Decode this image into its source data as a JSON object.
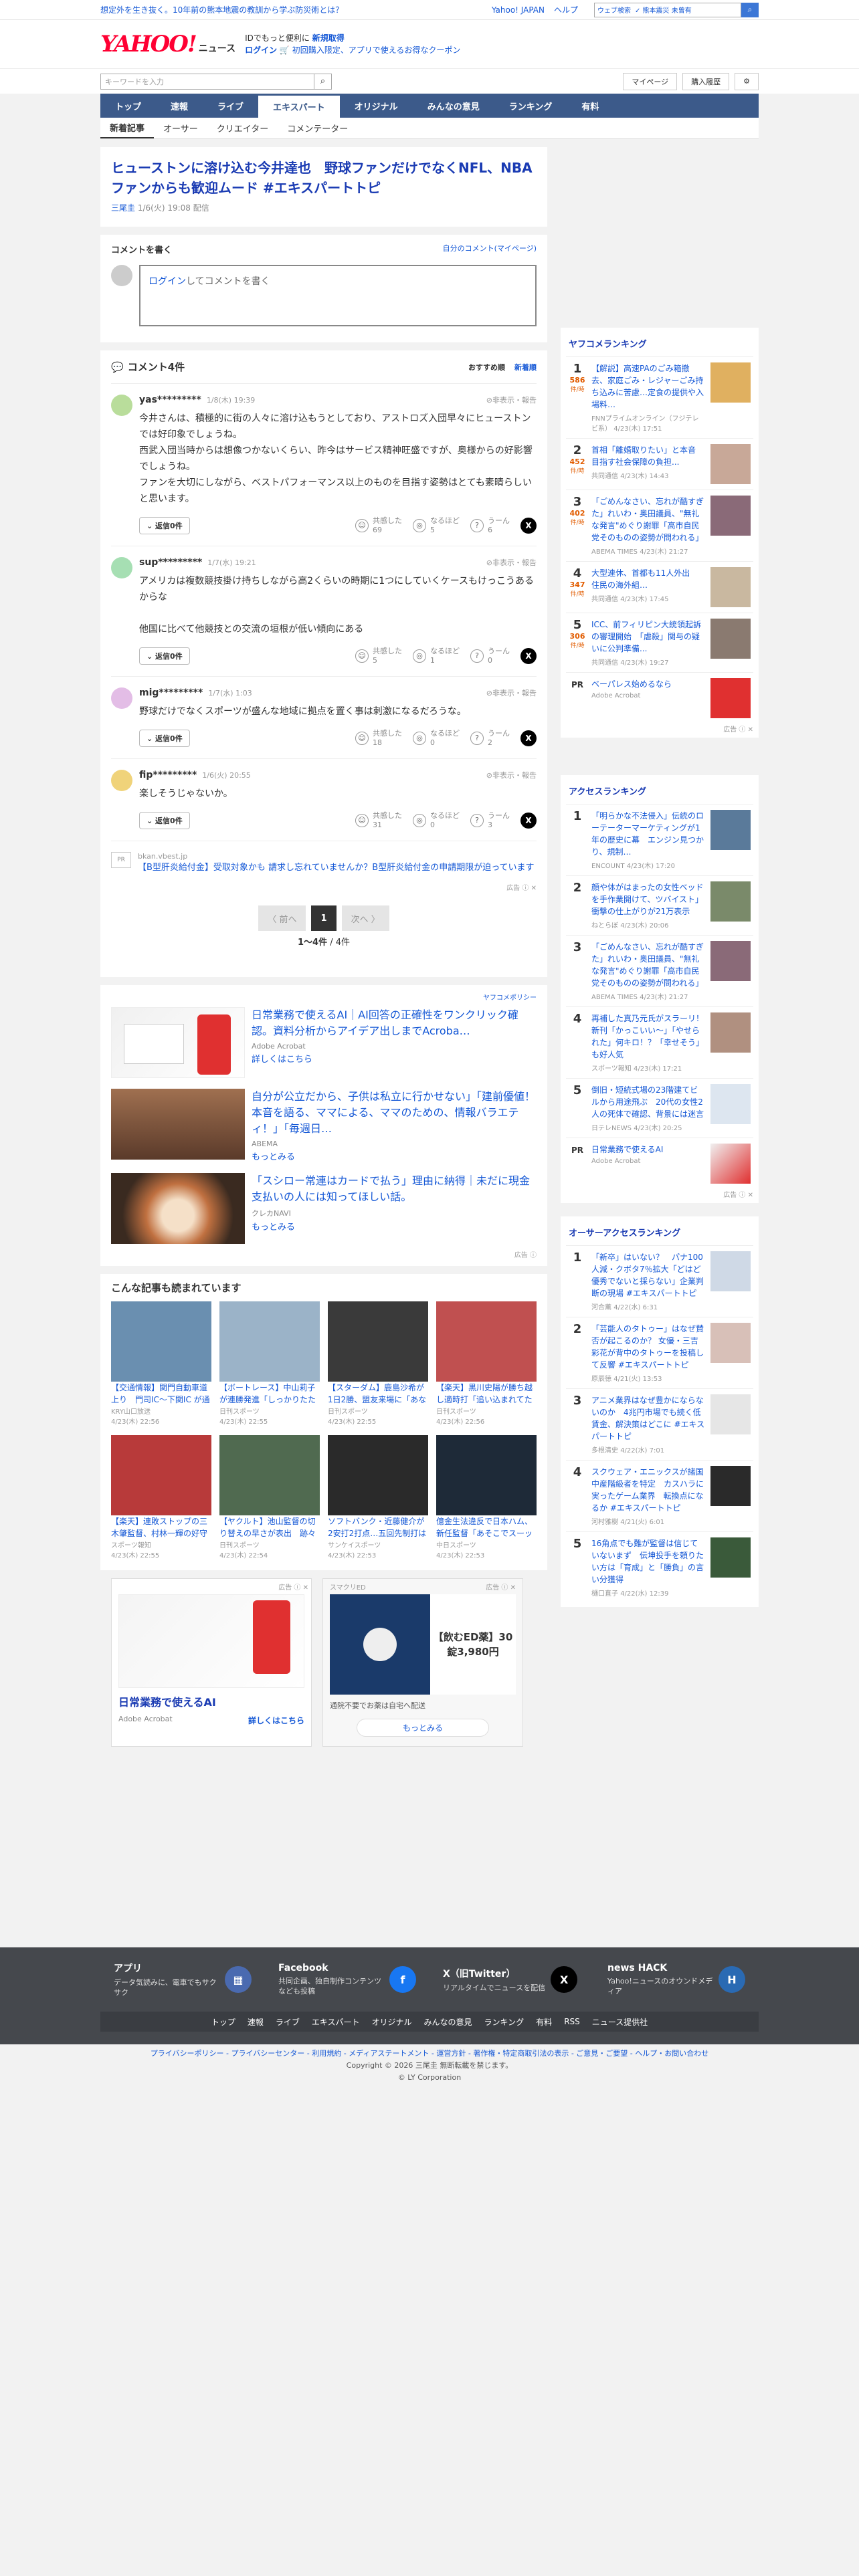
{
  "topbar": {
    "promo": "想定外を生き抜く。10年前の熊本地震の教訓から学ぶ防災術とは？",
    "links": [
      "Yahoo! JAPAN",
      "ヘルプ"
    ],
    "search_placeholder": "ウェブ検索",
    "search_tag": "✓ 熊本震災 未曾有"
  },
  "header": {
    "logo": "YAHOO!",
    "logo_sub": "JAPAN",
    "logo_news": "ニュース",
    "promo1": "IDでもっと便利に",
    "promo1b": "新規取得",
    "promo2a": "ログイン",
    "promo2b": "初回購入限定、アプリで使えるお得なクーポン"
  },
  "search": {
    "placeholder": "キーワードを入力",
    "mypage": "マイページ",
    "history": "購入履歴"
  },
  "nav": {
    "items": [
      "トップ",
      "速報",
      "ライブ",
      "エキスパート",
      "オリジナル",
      "みんなの意見",
      "ランキング",
      "有料"
    ],
    "active": 3
  },
  "subnav": {
    "items": [
      "新着記事",
      "オーサー",
      "クリエイター",
      "コメンテーター"
    ]
  },
  "article": {
    "title": "ヒューストンに溶け込む今井達也　野球ファンだけでなくNFL、NBAファンからも歓迎ムード #エキスパートトピ",
    "author": "三尾圭",
    "date": "1/6(火) 19:08 配信"
  },
  "comment_write": {
    "heading": "コメントを書く",
    "my_comments": "自分のコメント(マイページ)",
    "login": "ログイン",
    "placeholder": "してコメントを書く"
  },
  "comments": {
    "heading": "コメント4件",
    "sort_recommended": "おすすめ順",
    "sort_new": "新着順",
    "report": "非表示・報告",
    "reply_label": "返信0件",
    "items": [
      {
        "name": "yas*********",
        "time": "1/8(木) 19:39",
        "text": "今井さんは、積極的に街の人々に溶け込もうとしており、アストロズ入団早々にヒューストンでは好印象でしょうね。\n西武入団当時からは想像つかないくらい、昨今はサービス精神旺盛ですが、奥様からの好影響でしょうね。\nファンを大切にしながら、ベストパフォーマンス以上のものを目指す姿勢はとても素晴らしいと思います。",
        "agree": "69",
        "think": "5",
        "hmm": "6",
        "avatar": "#b9dd9b"
      },
      {
        "name": "sup*********",
        "time": "1/7(水) 19:21",
        "text": "アメリカは複数競技掛け持ちしながら高2くらいの時期に1つにしていくケースもけっこうあるからな\n\n他国に比べて他競技との交流の垣根が低い傾向にある",
        "agree": "5",
        "think": "1",
        "hmm": "0",
        "avatar": "#a6dfb3"
      },
      {
        "name": "mig*********",
        "time": "1/7(水) 1:03",
        "text": "野球だけでなくスポーツが盛んな地域に拠点を置く事は刺激になるだろうな。",
        "agree": "18",
        "think": "0",
        "hmm": "2",
        "avatar": "#e3bde6"
      },
      {
        "name": "fip*********",
        "time": "1/6(火) 20:55",
        "text": "楽しそうじゃないか。",
        "agree": "31",
        "think": "0",
        "hmm": "3",
        "avatar": "#f0d37a"
      }
    ],
    "react_agree": "共感した",
    "react_think": "なるほど",
    "react_hmm": "うーん"
  },
  "pr_ad": {
    "badge": "PR",
    "source": "bkan.vbest.jp",
    "text": "【B型肝炎給付金】受取対象かも 請求し忘れていませんか？B型肝炎給付金の申請期限が迫っています",
    "admark": "広告 ⓘ ✕"
  },
  "pager": {
    "prev": "〈 前へ",
    "cur": "1",
    "next": "次へ 〉",
    "count_a": "1〜4件",
    "count_b": " / 4件"
  },
  "adlist": {
    "policy": "ヤフコメポリシー",
    "items": [
      {
        "title": "日常業務で使えるAI｜AI回答の正確性をワンクリック確認。資料分析からアイデア出しまでAcroba…",
        "src": "Adobe Acrobat",
        "more": "詳しくはこちら"
      },
      {
        "title": "自分が公立だから、子供は私立に行かせない」「建前優値！本音を語る、ママによる、ママのための、情報バラエティ！」「毎週日…",
        "src": "ABEMA",
        "more": "もっとみる"
      },
      {
        "title": "「スシロー常連はカードで払う」理由に納得｜未だに現金支払いの人には知ってほしい話。",
        "src": "クレカNAVI",
        "more": "もっとみる"
      }
    ],
    "admark": "広告 ⓘ"
  },
  "recs": {
    "heading": "こんな記事も読まれています",
    "items": [
      {
        "t": "【交通情報】関門自動車道上り　門司IC〜下関IC が通行止め　雪・凍結…",
        "s": "KRY山口放送",
        "d": "4/23(木) 22:56",
        "c": "#6a8fb0"
      },
      {
        "t": "【ボートレース】中山莉子が連勝発進「しっかりたたいたら、もう…",
        "s": "日刊スポーツ",
        "d": "4/23(木) 22:55",
        "c": "#9bb3c8"
      },
      {
        "t": "【スターダム】鹿島沙希が1日2勝、盟友来場に「あなたは本当…",
        "s": "日刊スポーツ",
        "d": "4/23(木) 22:55",
        "c": "#3a3a3a"
      },
      {
        "t": "【楽天】黒川史陽が勝ち越し適時打「追い込まれてたんで、なん…",
        "s": "日刊スポーツ",
        "d": "4/23(木) 22:56",
        "c": "#c05050"
      },
      {
        "t": "【楽天】連敗ストップの三木肇監督、村林一輝の好守備を称賛「…",
        "s": "スポーツ報知",
        "d": "4/23(木) 22:55",
        "c": "#b83a3a"
      },
      {
        "t": "【ヤクルト】池山監督の切り替えの早さが表出　跡々と受け継が…",
        "s": "日刊スポーツ",
        "d": "4/23(木) 22:54",
        "c": "#506a50"
      },
      {
        "t": "ソフトバンク・近藤健介が2安打2打点…五回先制打は「反応で打…",
        "s": "サンケイスポーツ",
        "d": "4/23(木) 22:53",
        "c": "#2a2a2a"
      },
      {
        "t": "億金生法違反で日本ハム、新任監督「あそこでスーッとストライ…",
        "s": "中日スポーツ",
        "d": "4/23(木) 22:53",
        "c": "#1e2a38"
      }
    ]
  },
  "bottom_ads": [
    {
      "title": "日常業務で使えるAI",
      "src": "Adobe Acrobat",
      "more": "詳しくはこちら"
    },
    {
      "title": "【飲むED薬】30錠3,980円",
      "brand": "スマクリED",
      "src": "スマクリED",
      "note": "通院不要でお薬は自宅へ配送",
      "more": "もっとみる"
    }
  ],
  "side_yahocome": {
    "heading": "ヤフコメランキング",
    "items": [
      {
        "n": "1",
        "c": "586",
        "u": "件/時",
        "t": "【解説】高速PAのごみ箱撤去、家庭ごみ・レジャーごみ持ち込みに苦慮…定食の提供や入場料…",
        "s": "FNNプライムオンライン（フジテレビ系）",
        "d": "4/23(木) 17:51",
        "img": "#e0b060"
      },
      {
        "n": "2",
        "c": "452",
        "u": "件/時",
        "t": "首相「離婚取りたい」と本音　目指す社会保障の負担...",
        "s": "共同通信",
        "d": "4/23(木) 14:43",
        "img": "#c8a898"
      },
      {
        "n": "3",
        "c": "402",
        "u": "件/時",
        "t": "「ごめんなさい、忘れが酷すぎた」れいわ・奥田議員、\"無礼な発言\"めぐり謝罪「高市自民党そのものの姿勢が問われる」",
        "s": "ABEMA TIMES",
        "d": "4/23(木) 21:27",
        "img": "#8a6a78"
      },
      {
        "n": "4",
        "c": "347",
        "u": "件/時",
        "t": "大型連休、首都も11人外出　住民の海外組…",
        "s": "共同通信",
        "d": "4/23(木) 17:45",
        "img": "#c9b8a0"
      },
      {
        "n": "5",
        "c": "306",
        "u": "件/時",
        "t": "ICC、前フィリピン大統領起訴の審理開始　「虐殺」関与の疑いに公判準備...",
        "s": "共同通信",
        "d": "4/23(木) 19:27",
        "img": "#8a7a70"
      }
    ],
    "pr": {
      "t": "ベーパレス始めるなら",
      "s": "Adobe Acrobat"
    },
    "admark": "広告 ⓘ ✕"
  },
  "side_access": {
    "heading": "アクセスランキング",
    "items": [
      {
        "n": "1",
        "t": "「明らかな不法侵入」伝統のローテーターマーケティングが1年の歴史に幕　エンジン見つかり、規制…",
        "s": "ENCOUNT",
        "d": "4/23(木) 17:20",
        "img": "#5a7a9a"
      },
      {
        "n": "2",
        "t": "顔や体がはまったの女性ベッドを手作業開けて、ツバイスト」衝撃の仕上がりが21万表示",
        "s": "ねとらぼ",
        "d": "4/23(木) 20:06",
        "img": "#7a8a6a"
      },
      {
        "n": "3",
        "t": "「ごめんなさい、忘れが酷すぎた」れいわ・奥田議員、\"無礼な発言\"めぐり謝罪「高市自民党そのものの姿勢が問われる」",
        "s": "ABEMA TIMES",
        "d": "4/23(木) 21:27",
        "img": "#8a6a78"
      },
      {
        "n": "4",
        "t": "再補した真乃元氏がスラーリ！新刊「かっこいい〜」「やせられた」何キロ！？「幸せそう」も好人気",
        "s": "スポーツ報知",
        "d": "4/23(木) 17:21",
        "img": "#b09080"
      },
      {
        "n": "5",
        "t": "倒旧・短統式場の23階建てビルから用途飛ぶ　20代の女性2人の死体で確認、背景には迷言",
        "s": "日テレNEWS",
        "d": "4/23(木) 20:25",
        "img": "#dde6f0"
      }
    ],
    "pr": {
      "t": "日常業務で使えるAI",
      "s": "Adobe Acrobat"
    },
    "admark": "広告 ⓘ ✕"
  },
  "side_author": {
    "heading": "オーサーアクセスランキング",
    "items": [
      {
        "n": "1",
        "t": "「新卒」はいない？　パナ100人減・クボタ7％拡大「どはど優秀でないと採らない」企業判断の現場 #エキスパートトピ",
        "s": "河合薫",
        "d": "4/22(水) 6:31",
        "img": "#cfd9e6"
      },
      {
        "n": "2",
        "t": "「芸能人のタトゥー」はなぜ賛否が起こるのか？ 女優・三吉彩花が背中のタトゥーを投稿して反響 #エキスパートトピ",
        "s": "原辰徳",
        "d": "4/21(火) 13:53",
        "img": "#d8c0b8"
      },
      {
        "n": "3",
        "t": "アニメ業界はなぜ豊かにならないのか　4兆円市場でも続く低賃金、解決策はどこに #エキスパートトピ",
        "s": "多根清史",
        "d": "4/22(水) 7:01",
        "img": "#e6e6e6"
      },
      {
        "n": "4",
        "t": "スクウェア・エニックスが諸国中産階級者を特定　カスハラに実ったゲーム業界　転換点になるか #エキスパートトピ",
        "s": "河村雅樹",
        "d": "4/21(火) 6:01",
        "img": "#2a2a2a"
      },
      {
        "n": "5",
        "t": "16角点でも難が監督は信じていないまず　伝坤投手を頼りたい方は「育成」と「勝負」の言い分獲得",
        "s": "樋口直子",
        "d": "4/22(水) 12:39",
        "img": "#3a5a3a"
      }
    ]
  },
  "footer": {
    "apps": [
      {
        "t": "アプリ",
        "d": "データ気読みに、電車でもサクサク",
        "ic": "#4a6ab0",
        "g": "▦"
      },
      {
        "t": "Facebook",
        "d": "共同企画、独自制作コンテンツなども投稿",
        "ic": "#1877f2",
        "g": "f"
      },
      {
        "t": "X（旧Twitter）",
        "d": "リアルタイムでニュースを配信",
        "ic": "#000",
        "g": "X"
      },
      {
        "t": "news HACK",
        "d": "Yahoo!ニュースのオウンドメディア",
        "ic": "#2a6ab3",
        "g": "H"
      }
    ],
    "links": [
      "トップ",
      "速報",
      "ライブ",
      "エキスパート",
      "オリジナル",
      "みんなの意見",
      "ランキング",
      "有料",
      "RSS",
      "ニュース提供社"
    ]
  },
  "legal": {
    "links": "プライバシーポリシー - プライバシーセンター - 利用規約 - メディアステートメント - 運営方針 - 著作権・特定商取引法の表示 - ご意見・ご要望 - ヘルプ・お問い合わせ",
    "copy": "Copyright © 2026 三尾圭 無断転載を禁じます。",
    "corp": "© LY Corporation"
  },
  "colors": {
    "nav": "#3c5a8a",
    "link": "#1558d6",
    "title": "#1a3bb3",
    "rank_count": "#e25c00"
  }
}
